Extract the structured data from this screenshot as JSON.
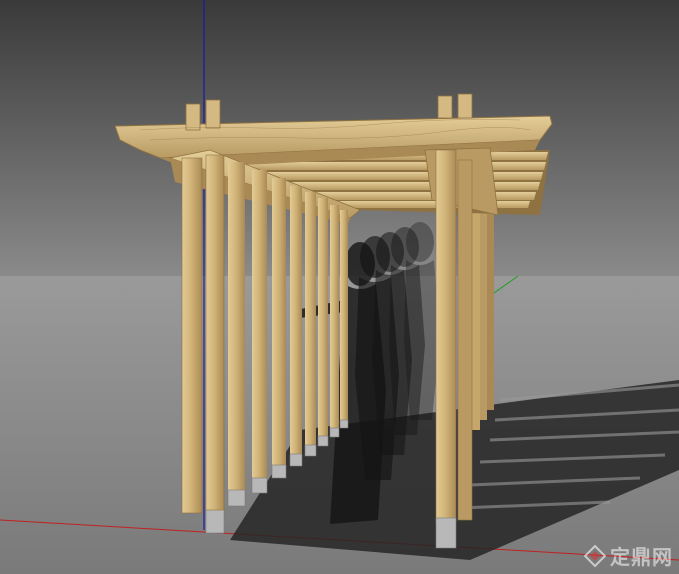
{
  "viewport": {
    "sky_top": "#3a3a3a",
    "sky_bottom": "#8a8a8a",
    "ground_top": "#9a9a9a",
    "ground_bottom": "#7a7a7a",
    "axis_blue": "#1a1aa0",
    "axis_red": "#c02020",
    "axis_green": "#20a020"
  },
  "model": {
    "wood_light": "#d8bf86",
    "wood_mid": "#c6a66a",
    "wood_dark": "#8f7242",
    "concrete": "#b8b8b8",
    "shadow": "#262626",
    "figure_color": "#141414",
    "figure_count": 5
  },
  "watermark": {
    "text": "定鼎网",
    "logo_icon": "diamond-logo-icon",
    "color": "#ffffff"
  }
}
